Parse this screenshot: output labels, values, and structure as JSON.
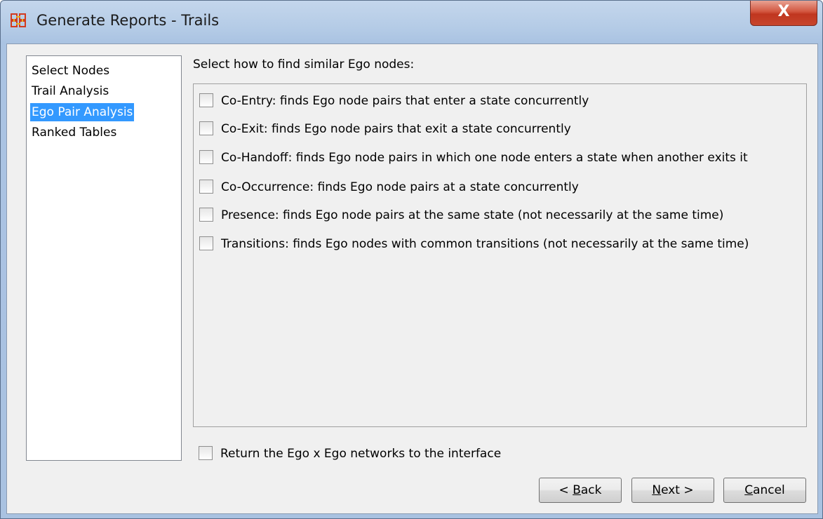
{
  "window": {
    "title": "Generate Reports - Trails",
    "close_label": "X"
  },
  "nav": {
    "items": [
      {
        "label": "Select Nodes",
        "selected": false
      },
      {
        "label": "Trail Analysis",
        "selected": false
      },
      {
        "label": "Ego Pair Analysis",
        "selected": true
      },
      {
        "label": "Ranked Tables",
        "selected": false
      }
    ]
  },
  "main": {
    "section_label": "Select how to find similar Ego nodes:",
    "options": [
      {
        "label": "Co-Entry: finds Ego node pairs that enter a state concurrently",
        "checked": false
      },
      {
        "label": "Co-Exit: finds Ego node pairs that exit a state concurrently",
        "checked": false
      },
      {
        "label": "Co-Handoff: finds Ego node pairs in which one node enters a state when another exits it",
        "checked": false
      },
      {
        "label": "Co-Occurrence: finds Ego node pairs at a state concurrently",
        "checked": false
      },
      {
        "label": "Presence: finds Ego node pairs at the same state (not necessarily at the same time)",
        "checked": false
      },
      {
        "label": "Transitions: finds Ego nodes with common transitions (not necessarily at the same time)",
        "checked": false
      }
    ],
    "return_option": {
      "label": "Return the Ego x Ego networks to the interface",
      "checked": false
    }
  },
  "buttons": {
    "back": {
      "prefix": "< ",
      "mnemonic": "B",
      "rest": "ack"
    },
    "next": {
      "prefix": "",
      "mnemonic": "N",
      "rest": "ext >"
    },
    "cancel": {
      "prefix": "",
      "mnemonic": "C",
      "rest": "ancel"
    }
  },
  "colors": {
    "selection": "#3399ff",
    "close_button": "#c7452c",
    "window_frame": "#a9c2e1"
  }
}
